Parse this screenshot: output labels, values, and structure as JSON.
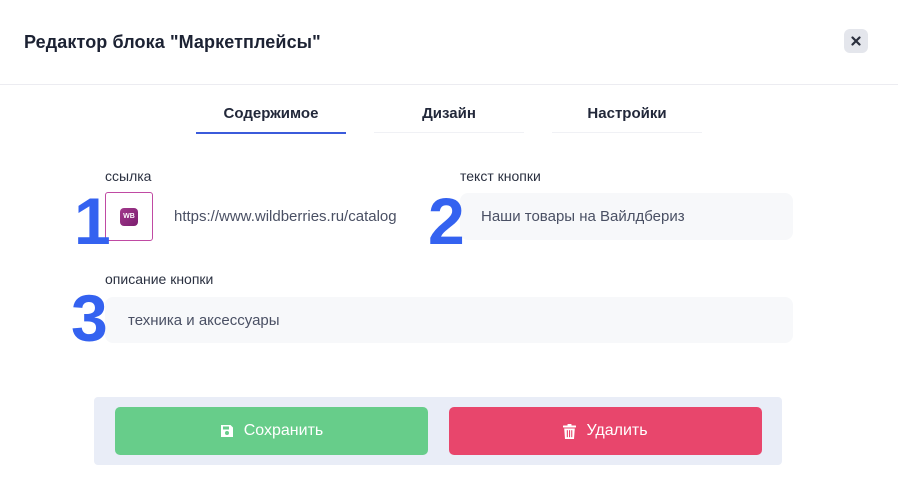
{
  "dialog": {
    "title": "Редактор блока \"Маркетплейсы\"",
    "close_icon": "close-icon"
  },
  "tabs": [
    {
      "label": "Содержимое",
      "active": true
    },
    {
      "label": "Дизайн",
      "active": false
    },
    {
      "label": "Настройки",
      "active": false
    }
  ],
  "form": {
    "link_label": "ссылка",
    "link_value": "https://www.wildberries.ru/catalog",
    "marketplace_logo_text": "WB",
    "button_text_label": "текст кнопки",
    "button_text_value": "Наши товары на Вайлдбериз",
    "button_description_label": "описание кнопки",
    "button_description_value": "техника и аксессуары"
  },
  "annotations": [
    "1",
    "2",
    "3"
  ],
  "actions": {
    "save_label": "Сохранить",
    "delete_label": "Удалить"
  },
  "colors": {
    "accent": "#3b5bdb",
    "annotation": "#3462f0",
    "save": "#67cd8a",
    "delete": "#e8466c"
  }
}
